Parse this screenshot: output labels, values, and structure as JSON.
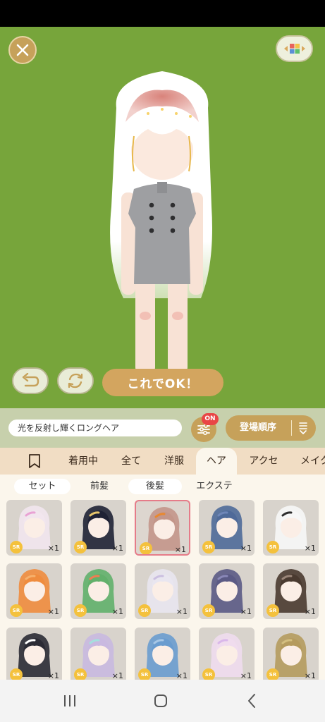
{
  "actions": {
    "ok_label": "これでOK！"
  },
  "item_name": "光を反射し輝くロングヘア",
  "filter": {
    "badge": "ON"
  },
  "sort": {
    "label": "登場順序"
  },
  "tabs": [
    {
      "label": "着用中"
    },
    {
      "label": "全て"
    },
    {
      "label": "洋服"
    },
    {
      "label": "ヘア",
      "active": true
    },
    {
      "label": "アクセ"
    },
    {
      "label": "メイク"
    }
  ],
  "subtabs": [
    {
      "label": "セット"
    },
    {
      "label": "前髪"
    },
    {
      "label": "後髪"
    },
    {
      "label": "エクステ"
    }
  ],
  "items": [
    {
      "rarity": "SR",
      "count": "×1",
      "hair": "#f2e6ee",
      "accent": "#e9a2d4"
    },
    {
      "rarity": "SR",
      "count": "×1",
      "hair": "#1f2235",
      "accent": "#e8c66c"
    },
    {
      "rarity": "SR",
      "count": "×1",
      "hair": "#c3968a",
      "accent": "#e9882f",
      "selected": true
    },
    {
      "rarity": "SR",
      "count": "×1",
      "hair": "#4f6a99",
      "accent": "#6f86b8"
    },
    {
      "rarity": "SR",
      "count": "×1",
      "hair": "#f7f7f7",
      "accent": "#2c2c2c"
    },
    {
      "rarity": "SR",
      "count": "×1",
      "hair": "#ef8c3e",
      "accent": "#f6b16d"
    },
    {
      "rarity": "SR",
      "count": "×1",
      "hair": "#62b06b",
      "accent": "#ef7d52"
    },
    {
      "rarity": "SR",
      "count": "×1",
      "hair": "#e9e6f0",
      "accent": "#cbbfe0"
    },
    {
      "rarity": "SR",
      "count": "×1",
      "hair": "#5b5a85",
      "accent": "#8a88b8"
    },
    {
      "rarity": "SR",
      "count": "×1",
      "hair": "#4a3a30",
      "accent": "#9a8578"
    },
    {
      "rarity": "SR",
      "count": "×1",
      "hair": "#2b2b35",
      "accent": "#ffffff"
    },
    {
      "rarity": "SR",
      "count": "×1",
      "hair": "#c9b9e0",
      "accent": "#a4e1dd"
    },
    {
      "rarity": "SR",
      "count": "×1",
      "hair": "#6a9ccf",
      "accent": "#a7c7e6"
    },
    {
      "rarity": "SR",
      "count": "×1",
      "hair": "#f0dcee",
      "accent": "#d9b7ea"
    },
    {
      "rarity": "SR",
      "count": "×1",
      "hair": "#b59b5e",
      "accent": "#d4bf80"
    }
  ],
  "colors": {
    "stage_bg": "#77a53b",
    "accent_gold": "#c6a15a",
    "badge_red": "#e94545",
    "tab_bg": "#f1ddc4",
    "selected_border": "#e57c89"
  }
}
